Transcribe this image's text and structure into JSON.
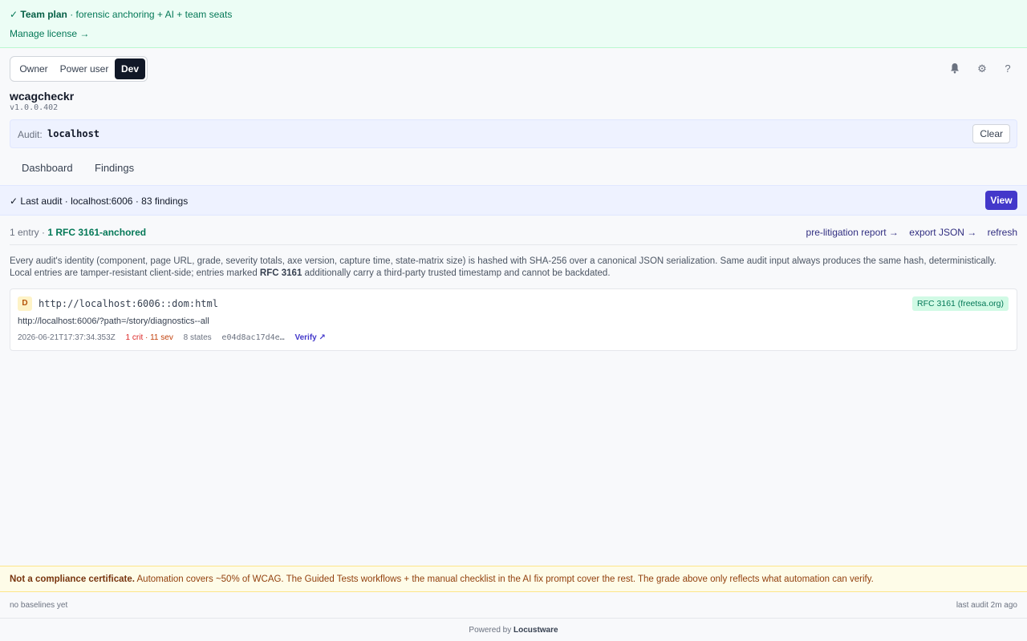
{
  "banner": {
    "check": "✓",
    "plan": "Team plan",
    "details": " · forensic anchoring + AI + team seats",
    "manage_link": "Manage license →"
  },
  "roles": {
    "items": [
      "Owner",
      "Power user",
      "Dev"
    ],
    "selected": "Dev"
  },
  "header_icons": {
    "bell": "bell-icon",
    "settings": "gear-icon",
    "help": "help-icon"
  },
  "app": {
    "name": "wcagcheckr",
    "version": "v1.0.0.402"
  },
  "audit": {
    "label": "Audit:",
    "target": "localhost",
    "clear_label": "Clear"
  },
  "tabs": [
    "Dashboard",
    "Findings"
  ],
  "status": {
    "text": "✓  Last audit · localhost:6006 · 83 findings",
    "view_label": "View"
  },
  "entries": {
    "count_text": "1 entry · ",
    "anchored_text": "1 RFC 3161-anchored",
    "links": [
      "pre-litigation report →",
      "export JSON →",
      "refresh"
    ]
  },
  "description": {
    "part1": "Every audit's identity (component, page URL, grade, severity totals, axe version, capture time, state-matrix size) is hashed with SHA-256 over a canonical JSON serialization. Same audit input always produces the same hash, deterministically. Local entries are tamper-resistant client-side; entries marked ",
    "bold": "RFC 3161",
    "part2": " additionally carry a third-party trusted timestamp and cannot be backdated."
  },
  "entry": {
    "grade": "D",
    "id": "http://localhost:6006::dom:html",
    "badge": "RFC 3161 (freetsa.org)",
    "url": "http://localhost:6006/?path=/story/diagnostics--all",
    "timestamp": "2026-06-21T17:37:34.353Z",
    "crit": "1 crit",
    "sev": " · 11 sev",
    "states": "8 states",
    "hash": "e04d8ac17d4e…",
    "verify": "Verify ↗"
  },
  "notice": {
    "bold": "Not a compliance certificate.",
    "text": " Automation covers ~50% of WCAG. The Guided Tests workflows + the manual checklist in the AI fix prompt cover the rest. The grade above only reflects what automation can verify."
  },
  "footer": {
    "left": "no baselines yet",
    "right": "last audit 2m ago",
    "powered_prefix": "Powered by ",
    "powered_brand": "Locustware"
  },
  "colors": {
    "accent": "#4338ca",
    "success": "#047857",
    "banner_bg": "#ecfdf5",
    "notice_bg": "#fefce8"
  }
}
